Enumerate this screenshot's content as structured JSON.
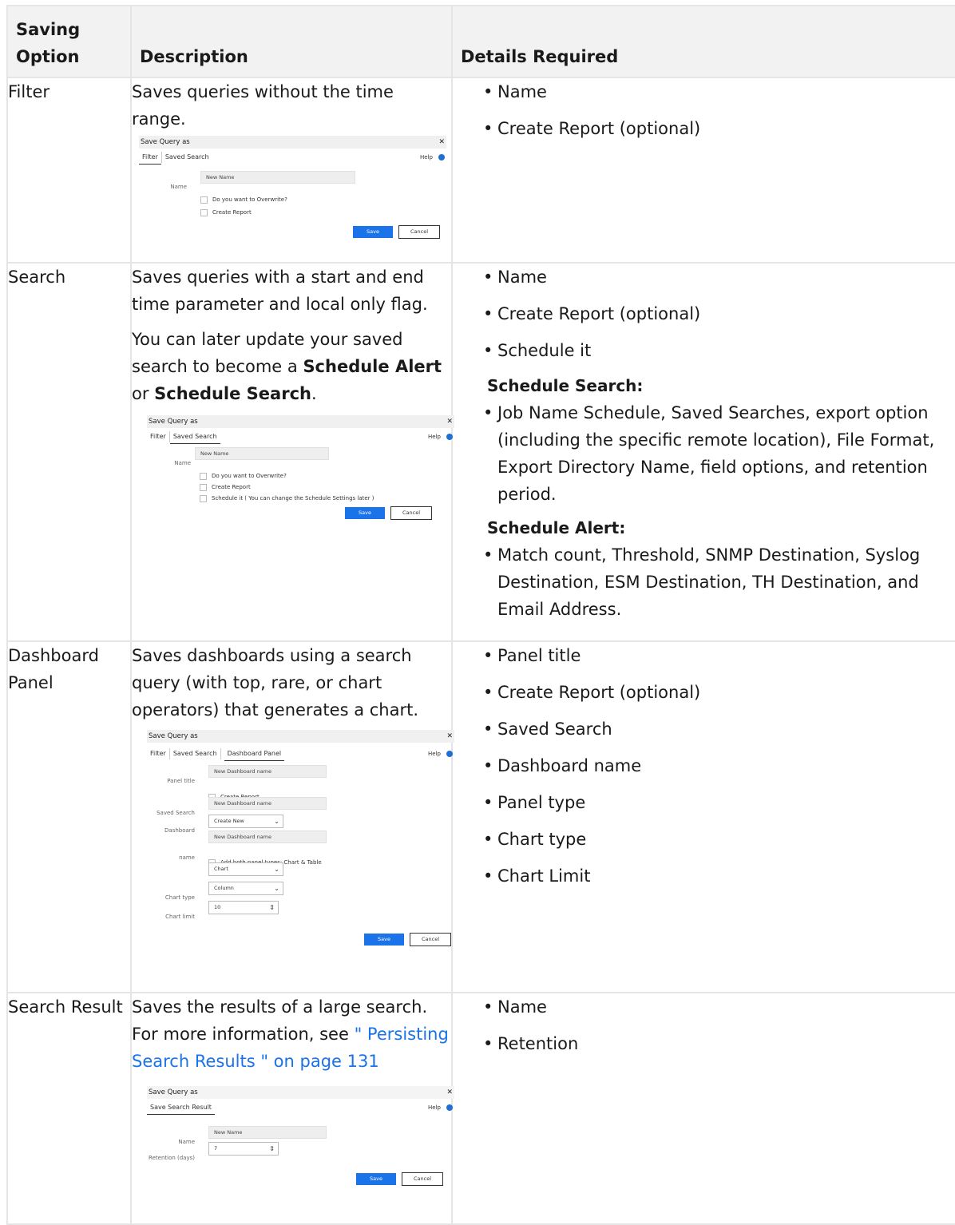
{
  "headers": {
    "saving_option": "Saving Option",
    "description": "Description",
    "details_required": "Details Required"
  },
  "rows": [
    {
      "option": "Filter",
      "description": [
        "Saves queries without the time range."
      ],
      "details": [
        "Name",
        "Create Report (optional)"
      ],
      "dialog": {
        "title": "Save Query as",
        "close": "✕",
        "tabs": [
          "Filter",
          "Saved Search"
        ],
        "active_tab": "Filter",
        "help": "Help",
        "name_label": "Name",
        "name_value": "New Name",
        "checkboxes": [
          "Do you want to Overwrite?",
          "Create Report"
        ],
        "save": "Save",
        "cancel": "Cancel"
      }
    },
    {
      "option": "Search",
      "description_1": "Saves queries with a start and end time parameter and local only flag.",
      "description_2_pre": "You can later update your saved search to become a ",
      "description_2_bold1": "Schedule Alert",
      "description_2_mid": " or ",
      "description_2_bold2": "Schedule Search",
      "description_2_post": ".",
      "details": [
        "Name",
        "Create Report (optional)",
        "Schedule it"
      ],
      "schedule_search_heading": "Schedule Search:",
      "schedule_search_item": "Job Name Schedule, Saved Searches, export option (including the specific remote location), File Format, Export Directory Name, field options, and retention period.",
      "schedule_alert_heading": "Schedule Alert:",
      "schedule_alert_item": "Match count, Threshold, SNMP Destination, Syslog Destination, ESM Destination, TH Destination, and Email Address.",
      "dialog": {
        "title": "Save Query as",
        "close": "✕",
        "tabs": [
          "Filter",
          "Saved Search"
        ],
        "active_tab": "Saved Search",
        "help": "Help",
        "name_label": "Name",
        "name_value": "New Name",
        "checkboxes": [
          "Do you want to Overwrite?",
          "Create Report",
          "Schedule it ( You can change the Schedule Settings later )"
        ],
        "save": "Save",
        "cancel": "Cancel"
      }
    },
    {
      "option": "Dashboard Panel",
      "description": "Saves dashboards using a search query (with top, rare, or chart operators) that generates a chart.",
      "details": [
        "Panel title",
        "Create Report (optional)",
        "Saved Search",
        "Dashboard name",
        "Panel type",
        "Chart type",
        "Chart Limit"
      ],
      "dialog": {
        "title": "Save Query as",
        "close": "✕",
        "tabs": [
          "Filter",
          "Saved Search",
          "Dashboard Panel"
        ],
        "help": "Help",
        "panel_title_label": "Panel title",
        "panel_title_value": "New Dashboard name",
        "create_report": "Create Report",
        "saved_search_label": "Saved Search",
        "saved_search_value": "New Dashboard name",
        "dashboard_name_label": "Dashboard name",
        "dashboard_select": "Create New",
        "dashboard_new_value": "New Dashboard name",
        "add_both": "Add both panel types: Chart & Table",
        "panel_type_select": "Chart",
        "chart_type_label": "Chart type",
        "chart_type_select": "Column",
        "chart_limit_label": "Chart limit",
        "chart_limit_value": "10",
        "save": "Save",
        "cancel": "Cancel"
      }
    },
    {
      "option": "Search Result",
      "description_pre": "Saves the results of a large search. For more information, see ",
      "link": "\" Persisting Search Results \" on page 131",
      "details": [
        "Name",
        "Retention"
      ],
      "dialog": {
        "title": "Save Query as",
        "close": "✕",
        "tab": "Save Search Result",
        "help": "Help",
        "name_label": "Name",
        "name_value": "New Name",
        "retention_label": "Retention (days)",
        "retention_value": "7",
        "save": "Save",
        "cancel": "Cancel"
      }
    }
  ]
}
